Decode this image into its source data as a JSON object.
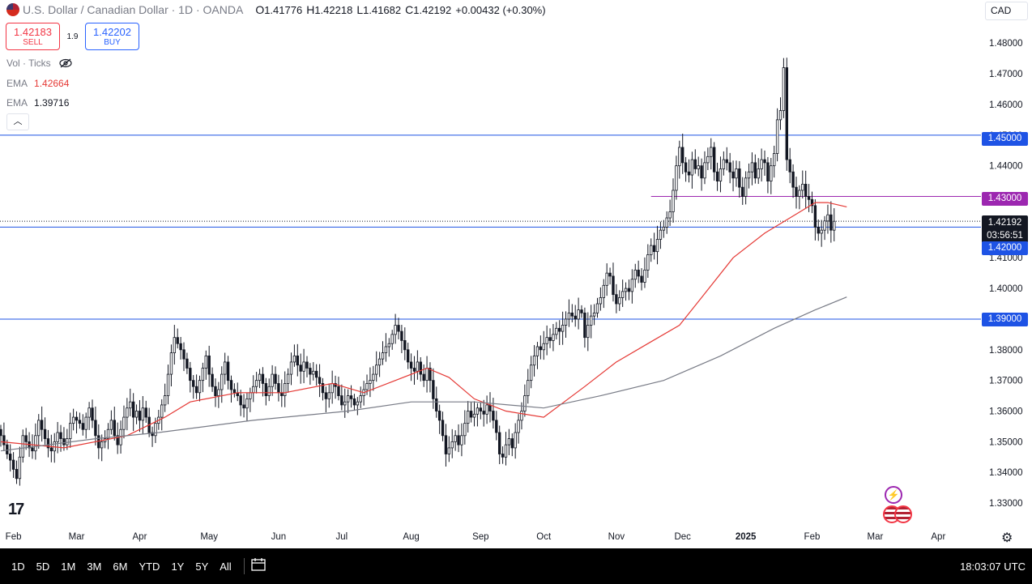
{
  "header": {
    "symbol": "U.S. Dollar / Canadian Dollar · 1D · OANDA",
    "ohlc": [
      {
        "k": "O",
        "v": "1.41776"
      },
      {
        "k": "H",
        "v": "1.42218"
      },
      {
        "k": "L",
        "v": "1.41682"
      },
      {
        "k": "C",
        "v": "1.42192"
      }
    ],
    "change": "+0.00432 (+0.30%)",
    "currency": "CAD"
  },
  "trade": {
    "sell_price": "1.42183",
    "sell_label": "SELL",
    "spread": "1.9",
    "buy_price": "1.42202",
    "buy_label": "BUY"
  },
  "indicators": [
    {
      "name": "Vol · Ticks",
      "value": ""
    },
    {
      "name": "EMA",
      "value": "1.42664"
    },
    {
      "name": "EMA",
      "value": "1.39716"
    }
  ],
  "price_tags": {
    "l1450": "1.45000",
    "l1430": "1.43000",
    "current": "1.42192",
    "countdown": "03:56:51",
    "l1420": "1.42000",
    "l1390": "1.39000"
  },
  "bottom": {
    "ranges": [
      "1D",
      "5D",
      "1M",
      "3M",
      "6M",
      "YTD",
      "1Y",
      "5Y",
      "All"
    ],
    "clock": "18:03:07 UTC"
  },
  "colors": {
    "up": "#131722",
    "down": "#131722",
    "ema_fast": "#e53935",
    "ema_slow": "#787b86",
    "hline_blue": "#1e53e5",
    "hline_purple": "#9c27b0"
  },
  "chart_data": {
    "type": "candlestick",
    "ylim": [
      1.325,
      1.4835
    ],
    "y_ticks": [
      "1.48000",
      "1.47000",
      "1.46000",
      "1.45000",
      "1.44000",
      "1.43000",
      "1.42000",
      "1.41000",
      "1.40000",
      "1.39000",
      "1.38000",
      "1.37000",
      "1.36000",
      "1.35000",
      "1.34000",
      "1.33000"
    ],
    "x_ticks": [
      {
        "label": "Feb",
        "idx": 4
      },
      {
        "label": "Mar",
        "idx": 24
      },
      {
        "label": "Apr",
        "idx": 44
      },
      {
        "label": "May",
        "idx": 66
      },
      {
        "label": "Jun",
        "idx": 88
      },
      {
        "label": "Jul",
        "idx": 108
      },
      {
        "label": "Aug",
        "idx": 130
      },
      {
        "label": "Sep",
        "idx": 152
      },
      {
        "label": "Oct",
        "idx": 172
      },
      {
        "label": "Nov",
        "idx": 195
      },
      {
        "label": "Dec",
        "idx": 216
      },
      {
        "label": "2025",
        "idx": 236,
        "bold": true
      },
      {
        "label": "Feb",
        "idx": 257
      },
      {
        "label": "Mar",
        "idx": 277
      },
      {
        "label": "Apr",
        "idx": 297
      }
    ],
    "x_index_range": [
      0,
      310
    ],
    "horizontal_lines": [
      {
        "price": 1.45,
        "color": "#1e53e5"
      },
      {
        "price": 1.43,
        "color": "#9c27b0",
        "from_idx": 206
      },
      {
        "price": 1.42,
        "color": "#1e53e5"
      },
      {
        "price": 1.39,
        "color": "#1e53e5"
      }
    ],
    "current_price": 1.42192,
    "closes": [
      1.352,
      1.349,
      1.346,
      1.344,
      1.341,
      1.338,
      1.345,
      1.352,
      1.35,
      1.348,
      1.347,
      1.352,
      1.357,
      1.354,
      1.351,
      1.348,
      1.347,
      1.35,
      1.353,
      1.351,
      1.349,
      1.351,
      1.356,
      1.358,
      1.357,
      1.356,
      1.354,
      1.358,
      1.361,
      1.357,
      1.352,
      1.348,
      1.35,
      1.351,
      1.354,
      1.357,
      1.352,
      1.349,
      1.354,
      1.358,
      1.361,
      1.363,
      1.358,
      1.36,
      1.357,
      1.361,
      1.358,
      1.353,
      1.352,
      1.356,
      1.358,
      1.362,
      1.365,
      1.372,
      1.379,
      1.384,
      1.382,
      1.38,
      1.377,
      1.374,
      1.37,
      1.368,
      1.366,
      1.37,
      1.374,
      1.378,
      1.372,
      1.368,
      1.365,
      1.367,
      1.372,
      1.376,
      1.37,
      1.367,
      1.366,
      1.365,
      1.362,
      1.361,
      1.364,
      1.366,
      1.368,
      1.37,
      1.372,
      1.369,
      1.365,
      1.368,
      1.372,
      1.369,
      1.366,
      1.365,
      1.369,
      1.372,
      1.376,
      1.378,
      1.375,
      1.373,
      1.376,
      1.374,
      1.372,
      1.373,
      1.371,
      1.369,
      1.366,
      1.364,
      1.366,
      1.369,
      1.368,
      1.365,
      1.362,
      1.363,
      1.365,
      1.364,
      1.362,
      1.363,
      1.365,
      1.367,
      1.369,
      1.37,
      1.372,
      1.375,
      1.377,
      1.379,
      1.381,
      1.382,
      1.385,
      1.388,
      1.386,
      1.383,
      1.38,
      1.376,
      1.374,
      1.373,
      1.376,
      1.372,
      1.37,
      1.374,
      1.37,
      1.364,
      1.36,
      1.357,
      1.352,
      1.346,
      1.348,
      1.35,
      1.352,
      1.349,
      1.352,
      1.356,
      1.36,
      1.358,
      1.359,
      1.361,
      1.36,
      1.359,
      1.362,
      1.36,
      1.357,
      1.353,
      1.346,
      1.345,
      1.349,
      1.351,
      1.348,
      1.353,
      1.357,
      1.36,
      1.365,
      1.37,
      1.375,
      1.378,
      1.381,
      1.38,
      1.382,
      1.384,
      1.383,
      1.385,
      1.387,
      1.386,
      1.388,
      1.39,
      1.392,
      1.391,
      1.39,
      1.393,
      1.392,
      1.384,
      1.388,
      1.391,
      1.392,
      1.395,
      1.397,
      1.401,
      1.405,
      1.404,
      1.398,
      1.395,
      1.397,
      1.399,
      1.4,
      1.399,
      1.403,
      1.406,
      1.404,
      1.402,
      1.406,
      1.411,
      1.414,
      1.412,
      1.416,
      1.419,
      1.42,
      1.423,
      1.425,
      1.432,
      1.44,
      1.446,
      1.441,
      1.438,
      1.437,
      1.442,
      1.439,
      1.44,
      1.436,
      1.441,
      1.443,
      1.446,
      1.438,
      1.435,
      1.439,
      1.442,
      1.441,
      1.438,
      1.436,
      1.439,
      1.433,
      1.43,
      1.436,
      1.438,
      1.441,
      1.436,
      1.439,
      1.442,
      1.441,
      1.435,
      1.44,
      1.444,
      1.455,
      1.458,
      1.472,
      1.442,
      1.438,
      1.433,
      1.43,
      1.432,
      1.434,
      1.43,
      1.429,
      1.427,
      1.42,
      1.418,
      1.419,
      1.422,
      1.424,
      1.419,
      1.4219
    ],
    "ema_fast_points": [
      [
        0,
        1.35
      ],
      [
        20,
        1.348
      ],
      [
        40,
        1.352
      ],
      [
        52,
        1.358
      ],
      [
        60,
        1.363
      ],
      [
        75,
        1.366
      ],
      [
        90,
        1.366
      ],
      [
        105,
        1.369
      ],
      [
        115,
        1.366
      ],
      [
        125,
        1.37
      ],
      [
        135,
        1.374
      ],
      [
        142,
        1.371
      ],
      [
        150,
        1.364
      ],
      [
        160,
        1.36
      ],
      [
        172,
        1.358
      ],
      [
        185,
        1.368
      ],
      [
        195,
        1.376
      ],
      [
        205,
        1.382
      ],
      [
        215,
        1.388
      ],
      [
        222,
        1.397
      ],
      [
        232,
        1.41
      ],
      [
        242,
        1.418
      ],
      [
        250,
        1.423
      ],
      [
        258,
        1.428
      ],
      [
        262,
        1.428
      ],
      [
        268,
        1.4266
      ]
    ],
    "ema_slow_points": [
      [
        0,
        1.347
      ],
      [
        30,
        1.351
      ],
      [
        50,
        1.353
      ],
      [
        80,
        1.357
      ],
      [
        110,
        1.36
      ],
      [
        130,
        1.363
      ],
      [
        150,
        1.363
      ],
      [
        172,
        1.361
      ],
      [
        190,
        1.365
      ],
      [
        210,
        1.37
      ],
      [
        228,
        1.378
      ],
      [
        245,
        1.387
      ],
      [
        258,
        1.393
      ],
      [
        268,
        1.3972
      ]
    ]
  }
}
